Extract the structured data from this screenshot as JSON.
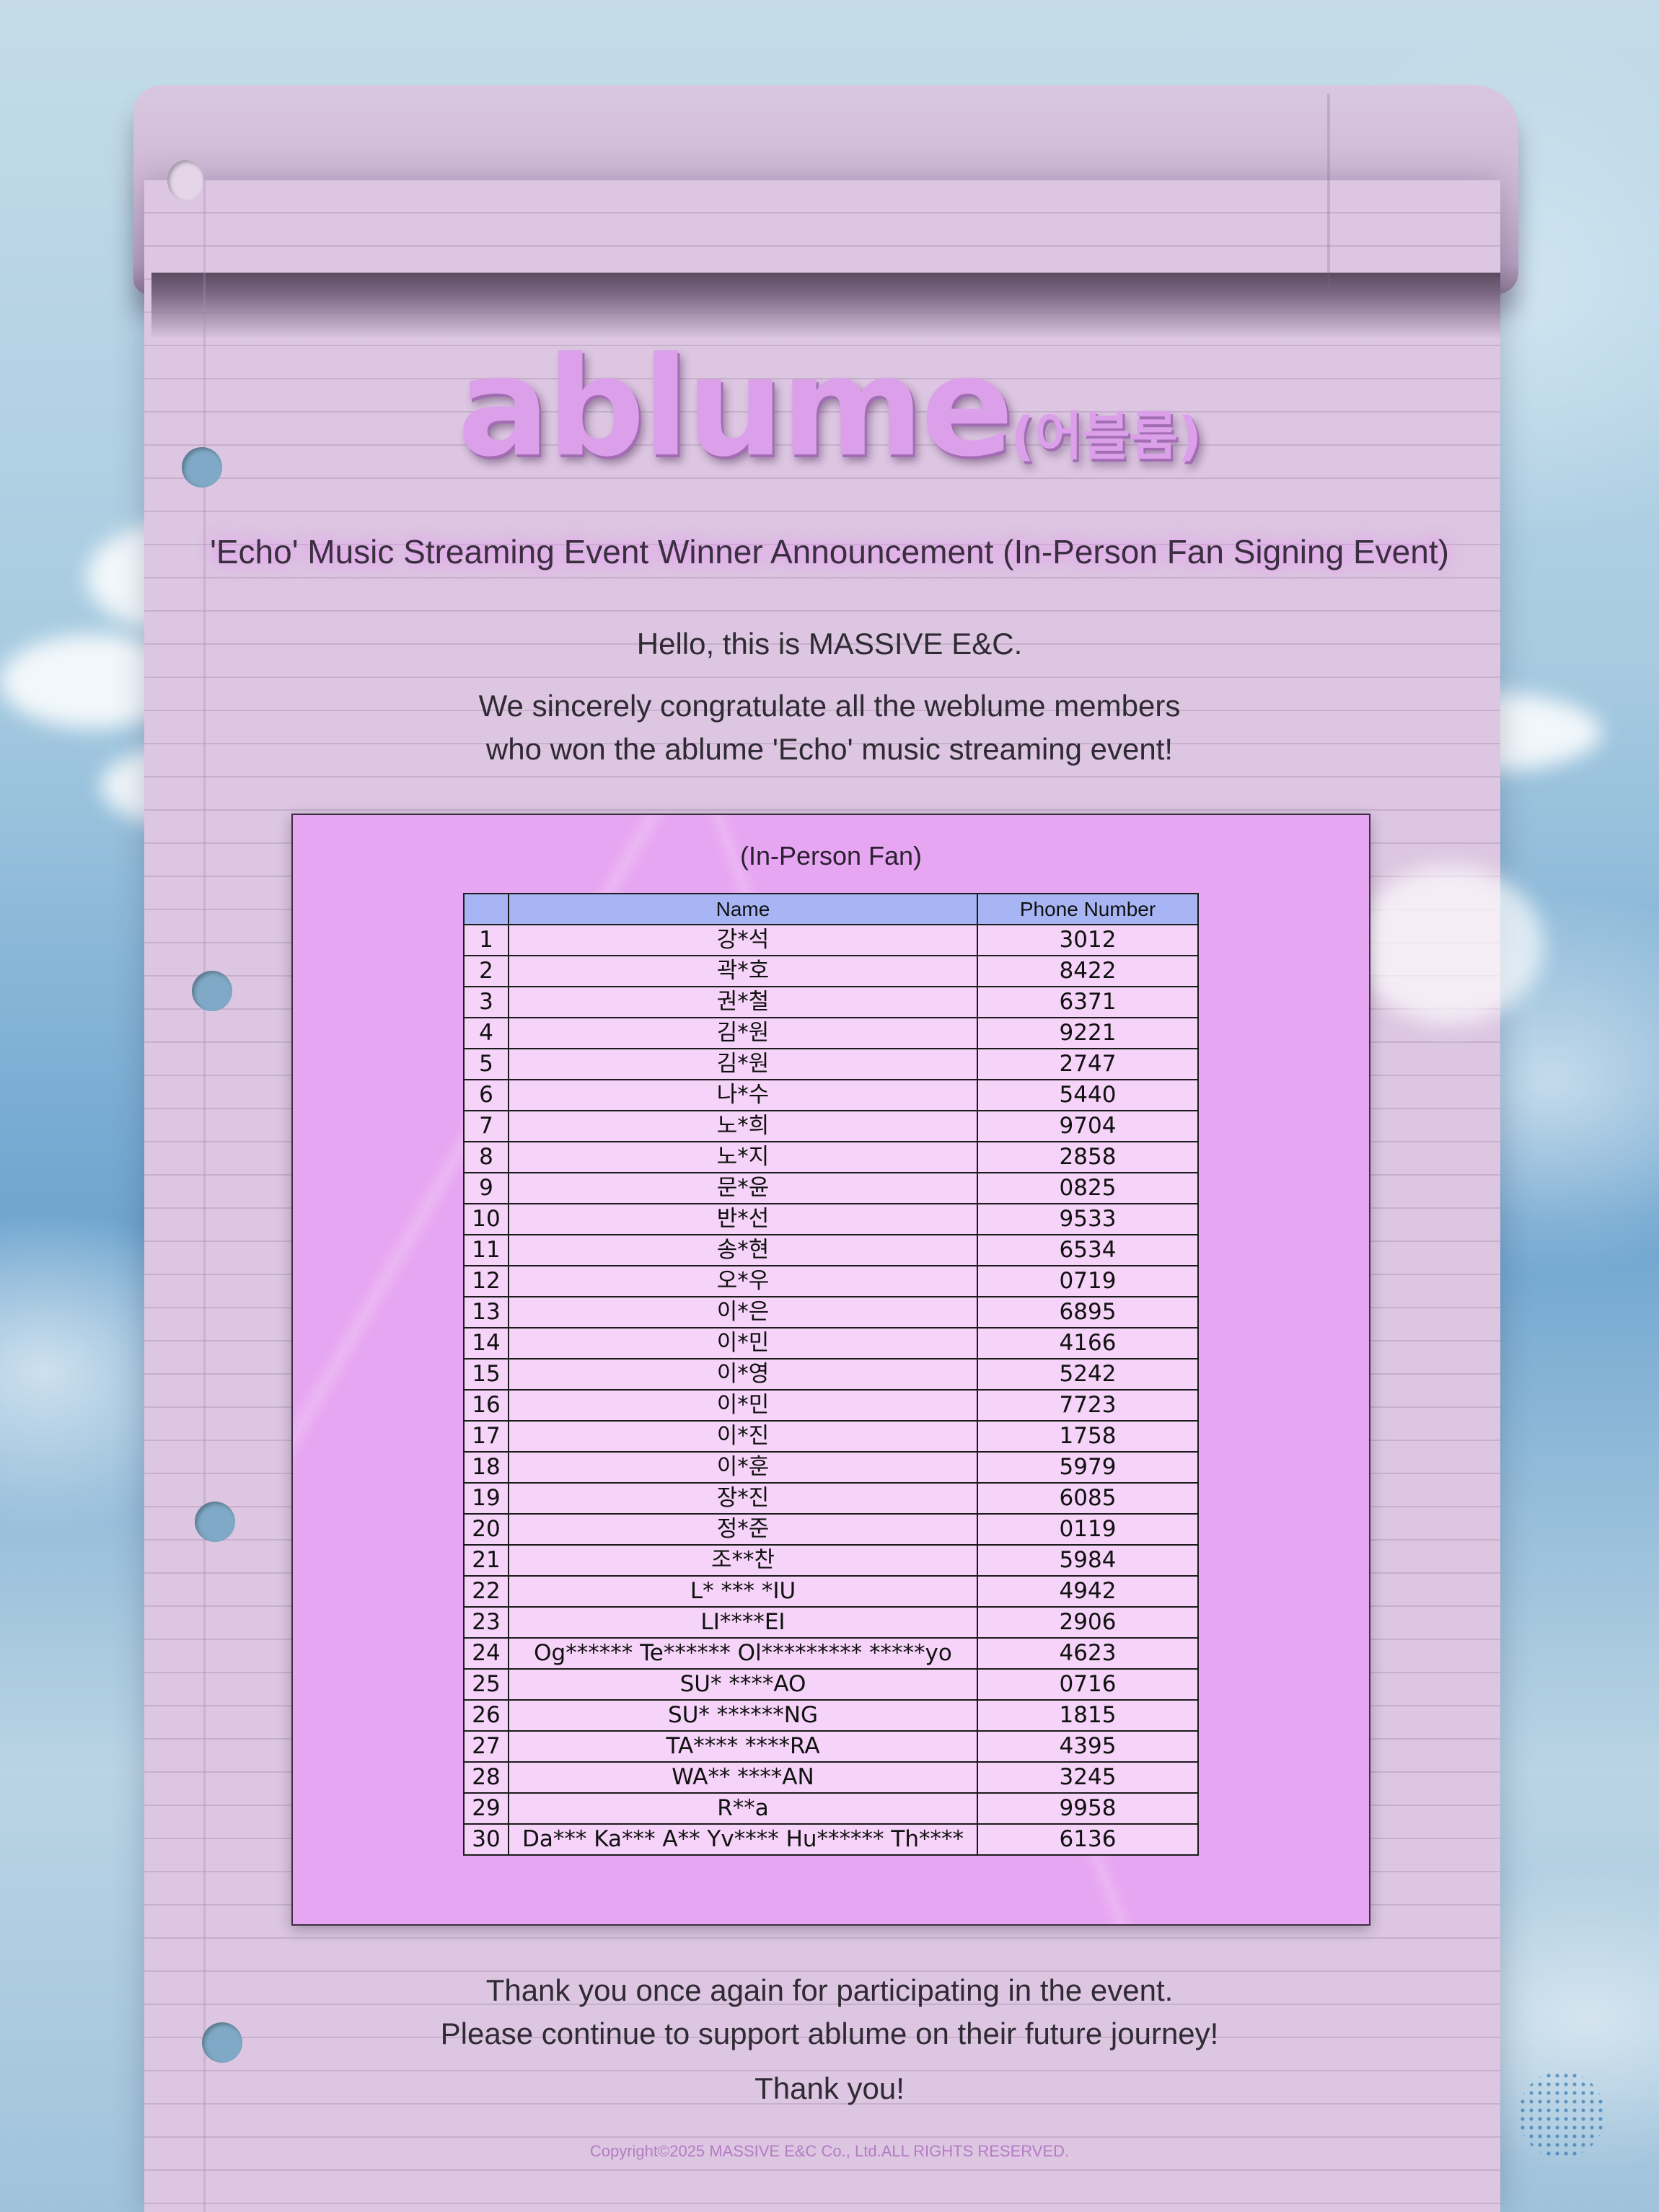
{
  "brand": {
    "name": "ablume",
    "name_kr": "(어블룸)"
  },
  "subtitle": "'Echo' Music Streaming Event Winner Announcement (In-Person Fan Signing Event)",
  "intro": {
    "greeting": "Hello, this is MASSIVE E&C.",
    "congrats_line1": "We sincerely congratulate all the weblume members",
    "congrats_line2": "who won the ablume 'Echo' music streaming event!"
  },
  "table": {
    "title": "(In-Person Fan)",
    "headers": [
      "",
      "Name",
      "Phone Number"
    ],
    "rows": [
      [
        "1",
        "강*석",
        "3012"
      ],
      [
        "2",
        "곽*호",
        "8422"
      ],
      [
        "3",
        "권*철",
        "6371"
      ],
      [
        "4",
        "김*원",
        "9221"
      ],
      [
        "5",
        "김*원",
        "2747"
      ],
      [
        "6",
        "나*수",
        "5440"
      ],
      [
        "7",
        "노*희",
        "9704"
      ],
      [
        "8",
        "노*지",
        "2858"
      ],
      [
        "9",
        "문*윤",
        "0825"
      ],
      [
        "10",
        "반*선",
        "9533"
      ],
      [
        "11",
        "송*현",
        "6534"
      ],
      [
        "12",
        "오*우",
        "0719"
      ],
      [
        "13",
        "이*은",
        "6895"
      ],
      [
        "14",
        "이*민",
        "4166"
      ],
      [
        "15",
        "이*영",
        "5242"
      ],
      [
        "16",
        "이*민",
        "7723"
      ],
      [
        "17",
        "이*진",
        "1758"
      ],
      [
        "18",
        "이*훈",
        "5979"
      ],
      [
        "19",
        "장*진",
        "6085"
      ],
      [
        "20",
        "정*준",
        "0119"
      ],
      [
        "21",
        "조**찬",
        "5984"
      ],
      [
        "22",
        "L* *** *IU",
        "4942"
      ],
      [
        "23",
        "LI****EI",
        "2906"
      ],
      [
        "24",
        "Og****** Te****** Ol********* *****yo",
        "4623"
      ],
      [
        "25",
        "SU* ****AO",
        "0716"
      ],
      [
        "26",
        "SU* ******NG",
        "1815"
      ],
      [
        "27",
        "TA**** ****RA",
        "4395"
      ],
      [
        "28",
        "WA** ****AN",
        "3245"
      ],
      [
        "29",
        "R**a",
        "9958"
      ],
      [
        "30",
        "Da*** Ka*** A** Yv**** Hu****** Th****",
        "6136"
      ]
    ]
  },
  "footer": {
    "line1": "Thank you once again for participating in the event.",
    "line2": "Please continue to support ablume on their future journey!",
    "line3": "Thank you!",
    "copyright": "Copyright©2025 MASSIVE E&C Co., Ltd.ALL RIGHTS RESERVED."
  }
}
